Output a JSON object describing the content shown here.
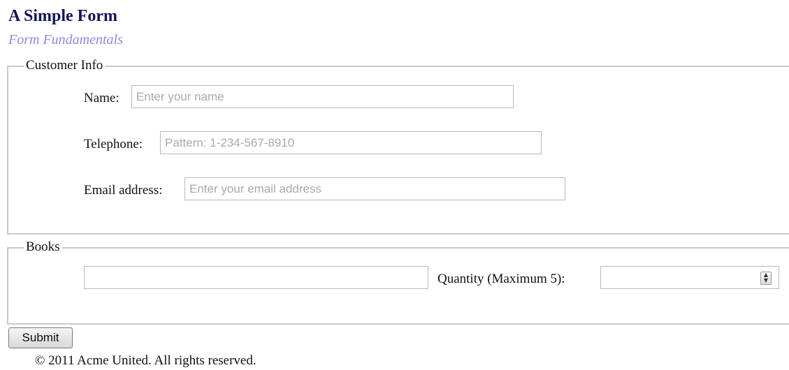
{
  "header": {
    "title": "A Simple Form",
    "subtitle": "Form Fundamentals"
  },
  "customer_info": {
    "legend": "Customer Info",
    "name_label": "Name:",
    "name_placeholder": "Enter your name",
    "telephone_label": "Telephone:",
    "telephone_placeholder": "Pattern: 1-234-567-8910",
    "email_label": "Email address:",
    "email_placeholder": "Enter your email address"
  },
  "books": {
    "legend": "Books",
    "book_value": "",
    "quantity_label": "Quantity (Maximum 5):",
    "quantity_value": ""
  },
  "submit_label": "Submit",
  "footer": "© 2011 Acme United. All rights reserved.",
  "colors": {
    "title": "#14145a",
    "subtitle": "#8a8ae0",
    "fieldset_border": "#c9c9c9",
    "placeholder": "#a9a9a9"
  },
  "icons": {
    "quantity_spinner": "spinner-arrows-icon"
  }
}
